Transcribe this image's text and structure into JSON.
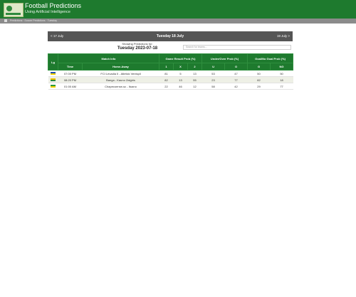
{
  "site": {
    "title": "Football Predictions",
    "subtitle": "Using Artificial Intelligence"
  },
  "breadcrumbs": "Predictions · Soccer Predictions · Tuesday",
  "nav": {
    "prev": "< 17 July",
    "date": "Tuesday 18 July",
    "next": "19 July >"
  },
  "summary": {
    "showing_label": "Showing Predictions for:",
    "showing_date": "Tuesday 2023-07-18"
  },
  "search": {
    "placeholder": "Search for teams..."
  },
  "table": {
    "header_groups": [
      "Lg",
      "Match Info",
      "Game Result Prob (%)",
      "Under/Over Prob (%)",
      "Goal/No Goal Prob (%)"
    ],
    "columns": [
      "Time",
      "Home-Away",
      "1",
      "X",
      "2",
      "U",
      "O",
      "G",
      "NG"
    ],
    "rows": [
      {
        "flag_color": "#1f4fb3",
        "flag_color2": "#f2d100",
        "time": "07:00 PM",
        "match": "FCI Levadia II - Atletick Ventspil",
        "p1": "81",
        "px": "5",
        "p2": "13",
        "u": "53",
        "o": "47",
        "g": "50",
        "ng": "50"
      },
      {
        "flag_color": "#f2c300",
        "flag_color2": "#2a8a3c",
        "time": "08:20 PM",
        "match": "Banga - Kauno Zalgiris",
        "p1": "82",
        "px": "13",
        "p2": "55",
        "u": "23",
        "o": "77",
        "g": "82",
        "ng": "18"
      },
      {
        "flag_color": "#2b9a3c",
        "flag_color2": "#f2d100",
        "time": "01:00 AM",
        "match": "Chapecoense-sc - Ituano",
        "p1": "22",
        "px": "46",
        "p2": "12",
        "u": "58",
        "o": "42",
        "g": "29",
        "ng": "77"
      }
    ]
  }
}
